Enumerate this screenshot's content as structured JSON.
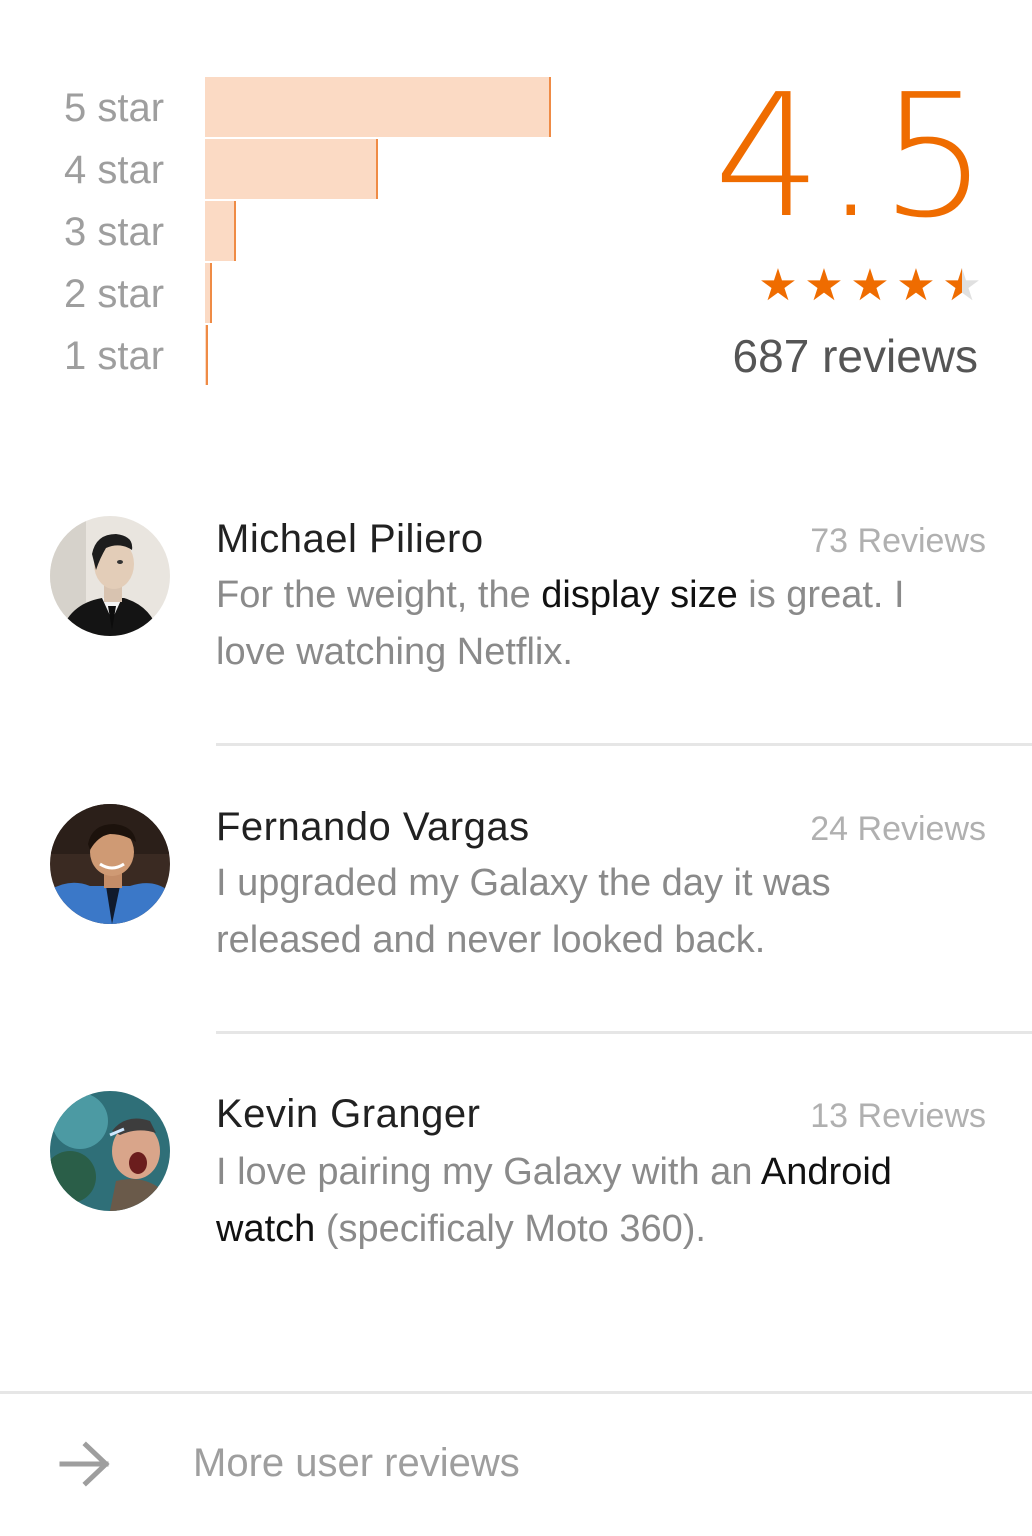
{
  "rating_breakdown": [
    {
      "label": "5 star",
      "fraction": 1.0
    },
    {
      "label": "4 star",
      "fraction": 0.5
    },
    {
      "label": "3 star",
      "fraction": 0.09
    },
    {
      "label": "2 star",
      "fraction": 0.02
    },
    {
      "label": "1 star",
      "fraction": 0.005
    }
  ],
  "summary": {
    "score": "4.5",
    "stars": 4.5,
    "review_count": "687 reviews",
    "accent_color": "#ef6c00",
    "bar_color": "#fbdac4"
  },
  "reviews": [
    {
      "name": "Michael Piliero",
      "count": "73 Reviews",
      "avatar": "avatar-michael",
      "text_parts": [
        {
          "text": "For the weight, the ",
          "highlight": false
        },
        {
          "text": "display size",
          "highlight": true
        },
        {
          "text": " is great. I love watching Netflix.",
          "highlight": false
        }
      ]
    },
    {
      "name": "Fernando Vargas",
      "count": "24 Reviews",
      "avatar": "avatar-fernando",
      "text_parts": [
        {
          "text": "I upgraded my Galaxy the day it was released and never looked back.",
          "highlight": false
        }
      ]
    },
    {
      "name": "Kevin Granger",
      "count": "13 Reviews",
      "avatar": "avatar-kevin",
      "text_parts": [
        {
          "text": "I love pairing my Galaxy with an ",
          "highlight": false
        },
        {
          "text": "Android watch",
          "highlight": true
        },
        {
          "text": " (specificaly Moto 360).",
          "highlight": false
        }
      ]
    }
  ],
  "footer": {
    "more_label": "More user reviews",
    "icon": "arrow-right-icon"
  }
}
